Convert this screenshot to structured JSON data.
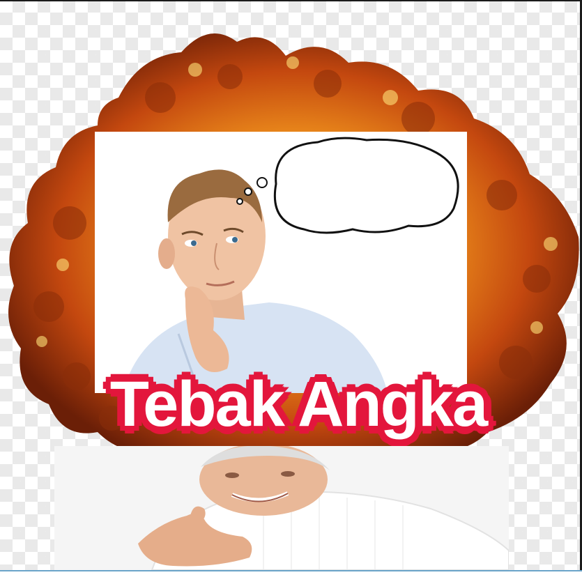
{
  "title": "Tebak Angka",
  "images": {
    "background": "checkerboard-transparency",
    "explosion": "explosion-illustration",
    "thinking_man": "thinking-man-photo",
    "thought_bubble": "thought-bubble-icon",
    "smiling_man": "smiling-man-thumbs-up-photo"
  },
  "colors": {
    "title_fill": "#ffffff",
    "title_outline": "#e3163c",
    "explosion_core": "#f6b02a",
    "explosion_dark": "#7a2a0c"
  }
}
